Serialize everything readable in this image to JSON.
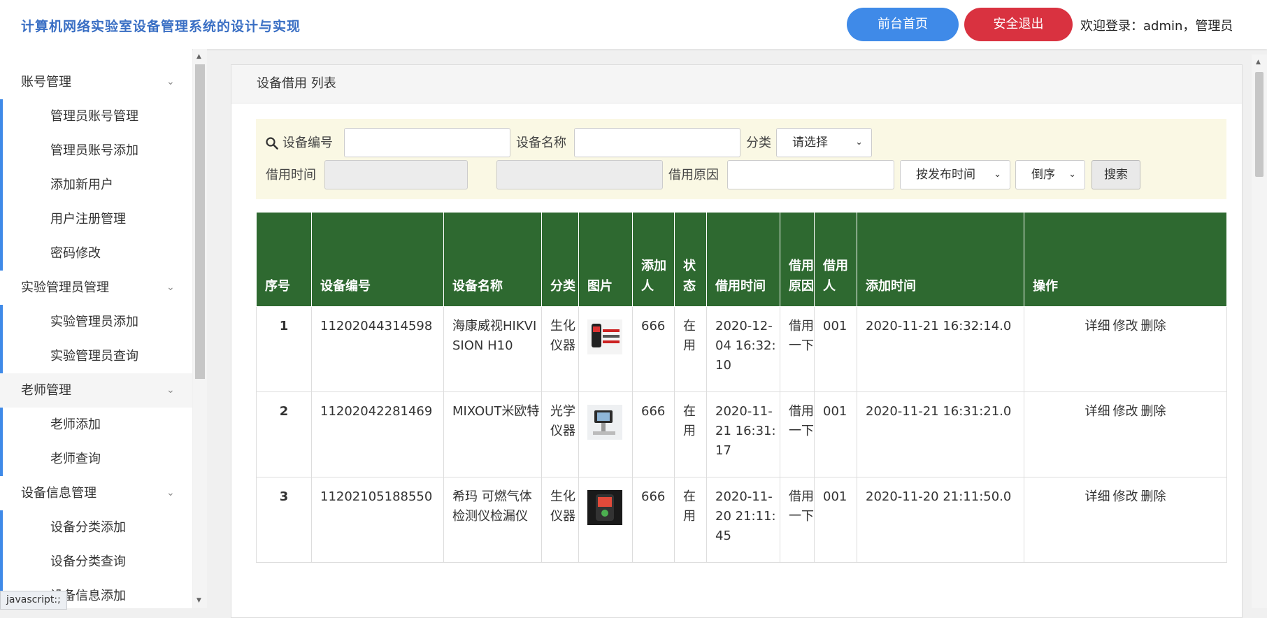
{
  "header": {
    "title": "计算机网络实验室设备管理系统的设计与实现",
    "home_button": "前台首页",
    "logout_button": "安全退出",
    "welcome": "欢迎登录：admin，管理员"
  },
  "sidebar": {
    "groups": [
      {
        "label": "账号管理",
        "items": [
          "管理员账号管理",
          "管理员账号添加",
          "添加新用户",
          "用户注册管理",
          "密码修改"
        ]
      },
      {
        "label": "实验管理员管理",
        "items": [
          "实验管理员添加",
          "实验管理员查询"
        ]
      },
      {
        "label": "老师管理",
        "items": [
          "老师添加",
          "老师查询"
        ]
      },
      {
        "label": "设备信息管理",
        "items": [
          "设备分类添加",
          "设备分类查询",
          "设备信息添加"
        ]
      }
    ]
  },
  "status_tip": "javascript:;",
  "panel": {
    "title": "设备借用 列表"
  },
  "search": {
    "device_no_label": "设备编号",
    "device_no_value": "",
    "device_name_label": "设备名称",
    "device_name_value": "",
    "category_label": "分类",
    "category_selected": "请选择",
    "borrow_time_label": "借用时间",
    "borrow_time_from": "",
    "borrow_time_sep": "-",
    "borrow_time_to": "",
    "reason_label": "借用原因",
    "reason_value": "",
    "sort_by_selected": "按发布时间",
    "order_selected": "倒序",
    "search_button": "搜索"
  },
  "table": {
    "headers": [
      "序号",
      "设备编号",
      "设备名称",
      "分类",
      "图片",
      "添加人",
      "状态",
      "借用时间",
      "借用原因",
      "借用人",
      "添加时间",
      "操作"
    ],
    "rows": [
      {
        "idx": "1",
        "device_no": "11202044314598",
        "name": "海康威视HIKVISION H10",
        "category": "生化仪器",
        "adder": "666",
        "status": "在用",
        "borrow_time": "2020-12-04 16:32:10",
        "reason": "借用一下",
        "borrower": "001",
        "added": "2020-11-21 16:32:14.0",
        "image": "thermal-camera-image"
      },
      {
        "idx": "2",
        "device_no": "11202042281469",
        "name": "MIXOUT米欧特",
        "category": "光学仪器",
        "adder": "666",
        "status": "在用",
        "borrow_time": "2020-11-21 16:31:17",
        "reason": "借用一下",
        "borrower": "001",
        "added": "2020-11-21 16:31:21.0",
        "image": "microscope-image"
      },
      {
        "idx": "3",
        "device_no": "11202105188550",
        "name": "希玛 可燃气体检测仪检漏仪",
        "category": "生化仪器",
        "adder": "666",
        "status": "在用",
        "borrow_time": "2020-11-20 21:11:45",
        "reason": "借用一下",
        "borrower": "001",
        "added": "2020-11-20 21:11:50.0",
        "image": "gas-detector-image"
      }
    ],
    "actions": {
      "detail": "详细",
      "edit": "修改",
      "delete": "删除"
    }
  }
}
